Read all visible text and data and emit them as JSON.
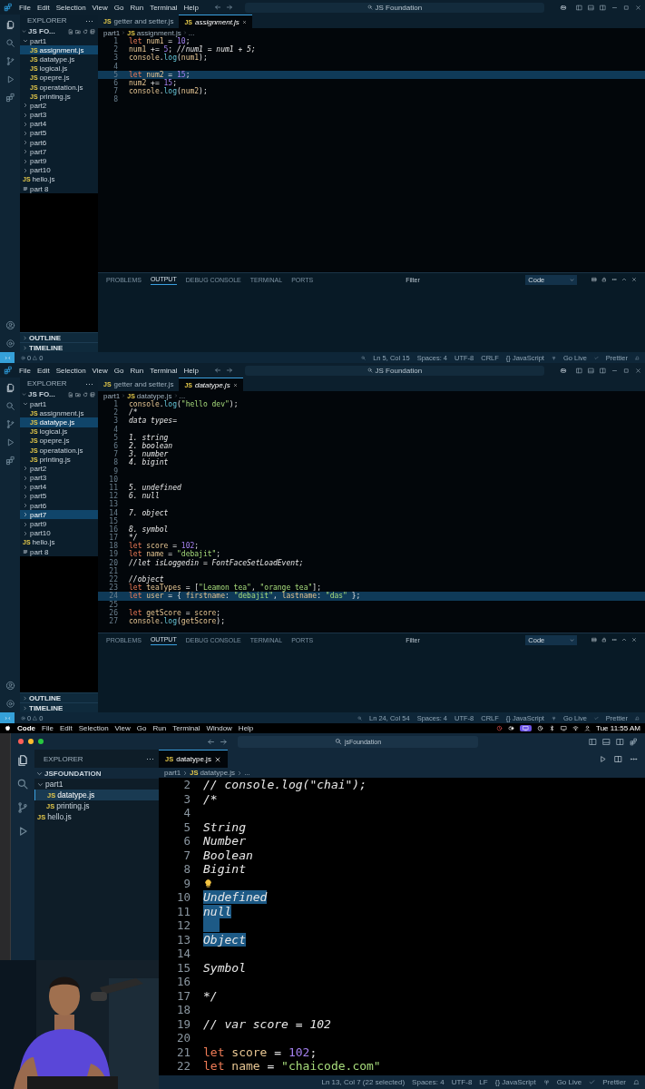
{
  "windows": [
    {
      "kind": "windows",
      "menu": [
        "File",
        "Edit",
        "Selection",
        "View",
        "Go",
        "Run",
        "Terminal",
        "Help"
      ],
      "title": "JS Foundation",
      "explorer": {
        "title": "EXPLORER",
        "more": "···",
        "root": "JS FO...",
        "tree": [
          {
            "label": "part1",
            "kind": "folder",
            "expanded": true,
            "selected": false,
            "children": [
              {
                "label": "assignment.js",
                "kind": "file",
                "badge": "JS",
                "selected": true
              },
              {
                "label": "datatype.js",
                "kind": "file",
                "badge": "JS",
                "selected": false
              },
              {
                "label": "logical.js",
                "kind": "file",
                "badge": "JS",
                "selected": false
              },
              {
                "label": "opepre.js",
                "kind": "file",
                "badge": "JS",
                "selected": false
              },
              {
                "label": "operatation.js",
                "kind": "file",
                "badge": "JS",
                "selected": false
              },
              {
                "label": "printing.js",
                "kind": "file",
                "badge": "JS",
                "selected": false
              }
            ]
          },
          {
            "label": "part2",
            "kind": "folder",
            "expanded": false,
            "selected": false
          },
          {
            "label": "part3",
            "kind": "folder",
            "expanded": false,
            "selected": false
          },
          {
            "label": "part4",
            "kind": "folder",
            "expanded": false,
            "selected": false
          },
          {
            "label": "part5",
            "kind": "folder",
            "expanded": false,
            "selected": false
          },
          {
            "label": "part6",
            "kind": "folder",
            "expanded": false,
            "selected": false
          },
          {
            "label": "part7",
            "kind": "folder",
            "expanded": false,
            "selected": false
          },
          {
            "label": "part9",
            "kind": "folder",
            "expanded": false,
            "selected": false
          },
          {
            "label": "part10",
            "kind": "folder",
            "expanded": false,
            "selected": false
          },
          {
            "label": "hello.js",
            "kind": "file",
            "badge": "JS",
            "selected": false
          },
          {
            "label": "part 8",
            "kind": "file",
            "selected": false
          }
        ],
        "sections": [
          "OUTLINE",
          "TIMELINE"
        ]
      },
      "tabs": [
        {
          "label": "getter and setter.js",
          "badge": "JS",
          "selected": false
        },
        {
          "label": "assignment.js",
          "badge": "JS",
          "selected": true
        }
      ],
      "breadcrumb": [
        {
          "text": "part1"
        },
        {
          "text": "assignment.js",
          "badge": "JS"
        },
        {
          "text": "..."
        }
      ],
      "lines": [
        {
          "number": "1",
          "selected": false,
          "tokens": [
            {
              "text": "let",
              "kind": "keyword"
            },
            {
              "text": " num1",
              "kind": "variable"
            },
            {
              "text": " = ",
              "kind": "plain"
            },
            {
              "text": "10",
              "kind": "number"
            },
            {
              "text": ";",
              "kind": "plain"
            }
          ]
        },
        {
          "number": "2",
          "selected": false,
          "tokens": [
            {
              "text": "num1",
              "kind": "variable"
            },
            {
              "text": " += ",
              "kind": "plain"
            },
            {
              "text": "5",
              "kind": "number"
            },
            {
              "text": "; ",
              "kind": "plain"
            },
            {
              "text": "//num1 = num1 + 5;",
              "kind": "comment"
            }
          ]
        },
        {
          "number": "3",
          "selected": false,
          "tokens": [
            {
              "text": "console",
              "kind": "variable"
            },
            {
              "text": ".",
              "kind": "plain"
            },
            {
              "text": "log",
              "kind": "function"
            },
            {
              "text": "(",
              "kind": "plain"
            },
            {
              "text": "num1",
              "kind": "variable"
            },
            {
              "text": ");",
              "kind": "plain"
            }
          ]
        },
        {
          "number": "4",
          "selected": false
        },
        {
          "number": "5",
          "selected": true,
          "tokens": [
            {
              "text": "let",
              "kind": "keyword"
            },
            {
              "text": " num2",
              "kind": "variable"
            },
            {
              "text": " = ",
              "kind": "plain"
            },
            {
              "text": "15",
              "kind": "number"
            },
            {
              "text": ";",
              "kind": "plain"
            }
          ]
        },
        {
          "number": "6",
          "selected": false,
          "tokens": [
            {
              "text": "num2",
              "kind": "variable"
            },
            {
              "text": " += ",
              "kind": "plain"
            },
            {
              "text": "15",
              "kind": "number"
            },
            {
              "text": ";",
              "kind": "plain"
            }
          ]
        },
        {
          "number": "7",
          "selected": false,
          "tokens": [
            {
              "text": "console",
              "kind": "variable"
            },
            {
              "text": ".",
              "kind": "plain"
            },
            {
              "text": "log",
              "kind": "function"
            },
            {
              "text": "(",
              "kind": "plain"
            },
            {
              "text": "num2",
              "kind": "variable"
            },
            {
              "text": ");",
              "kind": "plain"
            }
          ]
        },
        {
          "number": "8",
          "selected": false
        }
      ],
      "panel": {
        "tabs": [
          {
            "label": "PROBLEMS",
            "selected": false
          },
          {
            "label": "OUTPUT",
            "selected": true
          },
          {
            "label": "DEBUG CONSOLE",
            "selected": false
          },
          {
            "label": "TERMINAL",
            "selected": false
          },
          {
            "label": "PORTS",
            "selected": false
          }
        ],
        "filter_placeholder": "Filter",
        "channel": "Code"
      },
      "status": {
        "errors": "0",
        "warnings": "0",
        "items": [
          {
            "text": "Ln 5, Col 15"
          },
          {
            "text": "Spaces: 4"
          },
          {
            "text": "UTF-8"
          },
          {
            "text": "CRLF"
          },
          {
            "text": "{} JavaScript"
          },
          {
            "text": "Go Live"
          },
          {
            "text": "Prettier"
          }
        ]
      }
    },
    {
      "kind": "windows",
      "menu": [
        "File",
        "Edit",
        "Selection",
        "View",
        "Go",
        "Run",
        "Terminal",
        "Help"
      ],
      "title": "JS Foundation",
      "explorer": {
        "title": "EXPLORER",
        "more": "···",
        "root": "JS FO...",
        "tree": [
          {
            "label": "part1",
            "kind": "folder",
            "expanded": true,
            "selected": false,
            "children": [
              {
                "label": "assignment.js",
                "kind": "file",
                "badge": "JS",
                "selected": false
              },
              {
                "label": "datatype.js",
                "kind": "file",
                "badge": "JS",
                "selected": true
              },
              {
                "label": "logical.js",
                "kind": "file",
                "badge": "JS",
                "selected": false
              },
              {
                "label": "opepre.js",
                "kind": "file",
                "badge": "JS",
                "selected": false
              },
              {
                "label": "operatation.js",
                "kind": "file",
                "badge": "JS",
                "selected": false
              },
              {
                "label": "printing.js",
                "kind": "file",
                "badge": "JS",
                "selected": false
              }
            ]
          },
          {
            "label": "part2",
            "kind": "folder",
            "expanded": false,
            "selected": false
          },
          {
            "label": "part3",
            "kind": "folder",
            "expanded": false,
            "selected": false
          },
          {
            "label": "part4",
            "kind": "folder",
            "expanded": false,
            "selected": false
          },
          {
            "label": "part5",
            "kind": "folder",
            "expanded": false,
            "selected": false
          },
          {
            "label": "part6",
            "kind": "folder",
            "expanded": false,
            "selected": false
          },
          {
            "label": "part7",
            "kind": "folder",
            "expanded": false,
            "selected": true
          },
          {
            "label": "part9",
            "kind": "folder",
            "expanded": false,
            "selected": false
          },
          {
            "label": "part10",
            "kind": "folder",
            "expanded": false,
            "selected": false
          },
          {
            "label": "hello.js",
            "kind": "file",
            "badge": "JS",
            "selected": false
          },
          {
            "label": "part 8",
            "kind": "file",
            "selected": false
          }
        ],
        "sections": [
          "OUTLINE",
          "TIMELINE"
        ]
      },
      "tabs": [
        {
          "label": "getter and setter.js",
          "badge": "JS",
          "selected": false
        },
        {
          "label": "datatype.js",
          "badge": "JS",
          "selected": true
        }
      ],
      "breadcrumb": [
        {
          "text": "part1"
        },
        {
          "text": "datatype.js",
          "badge": "JS"
        },
        {
          "text": "..."
        }
      ],
      "lines": [
        {
          "number": "1",
          "selected": false,
          "tokens": [
            {
              "text": "console",
              "kind": "variable"
            },
            {
              "text": ".",
              "kind": "plain"
            },
            {
              "text": "log",
              "kind": "function"
            },
            {
              "text": "(",
              "kind": "plain"
            },
            {
              "text": "\"hello dev\"",
              "kind": "string"
            },
            {
              "text": ");",
              "kind": "plain"
            }
          ]
        },
        {
          "number": "2",
          "selected": false,
          "tokens": [
            {
              "text": "/*",
              "kind": "comment"
            }
          ]
        },
        {
          "number": "3",
          "selected": false,
          "tokens": [
            {
              "text": "data types=",
              "kind": "comment"
            }
          ]
        },
        {
          "number": "4",
          "selected": false
        },
        {
          "number": "5",
          "selected": false,
          "tokens": [
            {
              "text": "1. string",
              "kind": "comment"
            }
          ]
        },
        {
          "number": "6",
          "selected": false,
          "tokens": [
            {
              "text": "2. boolean",
              "kind": "comment"
            }
          ]
        },
        {
          "number": "7",
          "selected": false,
          "tokens": [
            {
              "text": "3. number",
              "kind": "comment"
            }
          ]
        },
        {
          "number": "8",
          "selected": false,
          "tokens": [
            {
              "text": "4. bigint",
              "kind": "comment"
            }
          ]
        },
        {
          "number": "9",
          "selected": false
        },
        {
          "number": "10",
          "selected": false
        },
        {
          "number": "11",
          "selected": false,
          "tokens": [
            {
              "text": "5. undefined",
              "kind": "comment"
            }
          ]
        },
        {
          "number": "12",
          "selected": false,
          "tokens": [
            {
              "text": "6. null",
              "kind": "comment"
            }
          ]
        },
        {
          "number": "13",
          "selected": false
        },
        {
          "number": "14",
          "selected": false,
          "tokens": [
            {
              "text": "7. object",
              "kind": "comment"
            }
          ]
        },
        {
          "number": "15",
          "selected": false
        },
        {
          "number": "16",
          "selected": false,
          "tokens": [
            {
              "text": "8. symbol",
              "kind": "comment"
            }
          ]
        },
        {
          "number": "17",
          "selected": false,
          "tokens": [
            {
              "text": "*/",
              "kind": "comment"
            }
          ]
        },
        {
          "number": "18",
          "selected": false,
          "tokens": [
            {
              "text": "let",
              "kind": "keyword"
            },
            {
              "text": " score",
              "kind": "variable"
            },
            {
              "text": " = ",
              "kind": "plain"
            },
            {
              "text": "102",
              "kind": "number"
            },
            {
              "text": ";",
              "kind": "plain"
            }
          ]
        },
        {
          "number": "19",
          "selected": false,
          "tokens": [
            {
              "text": "let",
              "kind": "keyword"
            },
            {
              "text": " name",
              "kind": "variable"
            },
            {
              "text": " = ",
              "kind": "plain"
            },
            {
              "text": "\"debajit\"",
              "kind": "string"
            },
            {
              "text": ";",
              "kind": "plain"
            }
          ]
        },
        {
          "number": "20",
          "selected": false,
          "tokens": [
            {
              "text": "//let isLoggedin = FontFaceSetLoadEvent;",
              "kind": "comment"
            }
          ]
        },
        {
          "number": "21",
          "selected": false
        },
        {
          "number": "22",
          "selected": false,
          "tokens": [
            {
              "text": "//object",
              "kind": "comment"
            }
          ]
        },
        {
          "number": "23",
          "selected": false,
          "tokens": [
            {
              "text": "let",
              "kind": "keyword"
            },
            {
              "text": " teaTypes",
              "kind": "variable"
            },
            {
              "text": " = [",
              "kind": "plain"
            },
            {
              "text": "\"Leamon tea\"",
              "kind": "string"
            },
            {
              "text": ", ",
              "kind": "plain"
            },
            {
              "text": "\"orange tea\"",
              "kind": "string"
            },
            {
              "text": "];",
              "kind": "plain"
            }
          ]
        },
        {
          "number": "24",
          "selected": true,
          "tokens": [
            {
              "text": "let",
              "kind": "keyword"
            },
            {
              "text": " user",
              "kind": "variable"
            },
            {
              "text": " = { ",
              "kind": "plain"
            },
            {
              "text": "firstname",
              "kind": "variable"
            },
            {
              "text": ": ",
              "kind": "plain"
            },
            {
              "text": "\"debajit\"",
              "kind": "string"
            },
            {
              "text": ", ",
              "kind": "plain"
            },
            {
              "text": "lastname",
              "kind": "variable"
            },
            {
              "text": ": ",
              "kind": "plain"
            },
            {
              "text": "\"das\"",
              "kind": "string"
            },
            {
              "text": " };",
              "kind": "plain"
            }
          ]
        },
        {
          "number": "25",
          "selected": false
        },
        {
          "number": "26",
          "selected": false,
          "tokens": [
            {
              "text": "let",
              "kind": "keyword"
            },
            {
              "text": " getScore",
              "kind": "variable"
            },
            {
              "text": " = ",
              "kind": "plain"
            },
            {
              "text": "score",
              "kind": "variable"
            },
            {
              "text": ";",
              "kind": "plain"
            }
          ]
        },
        {
          "number": "27",
          "selected": false,
          "tokens": [
            {
              "text": "console",
              "kind": "variable"
            },
            {
              "text": ".",
              "kind": "plain"
            },
            {
              "text": "log",
              "kind": "function"
            },
            {
              "text": "(",
              "kind": "plain"
            },
            {
              "text": "getScore",
              "kind": "variable"
            },
            {
              "text": ");",
              "kind": "plain"
            }
          ]
        }
      ],
      "panel": {
        "tabs": [
          {
            "label": "PROBLEMS",
            "selected": false
          },
          {
            "label": "OUTPUT",
            "selected": true
          },
          {
            "label": "DEBUG CONSOLE",
            "selected": false
          },
          {
            "label": "TERMINAL",
            "selected": false
          },
          {
            "label": "PORTS",
            "selected": false
          }
        ],
        "filter_placeholder": "Filter",
        "channel": "Code"
      },
      "status": {
        "errors": "0",
        "warnings": "0",
        "items": [
          {
            "text": "Ln 24, Col 54"
          },
          {
            "text": "Spaces: 4"
          },
          {
            "text": "UTF-8"
          },
          {
            "text": "CRLF"
          },
          {
            "text": "{} JavaScript"
          },
          {
            "text": "Go Live"
          },
          {
            "text": "Prettier"
          }
        ]
      }
    },
    {
      "kind": "mac",
      "menu": [
        "File",
        "Edit",
        "Selection",
        "View",
        "Go",
        "Run",
        "Terminal",
        "Window",
        "Help"
      ],
      "app": "Code",
      "clock": "Tue 11:55 AM",
      "title": "jsFoundation",
      "explorer": {
        "title": "EXPLORER",
        "more": "···",
        "root": "JSFOUNDATION",
        "tree": [
          {
            "label": "part1",
            "kind": "folder",
            "expanded": true,
            "selected": false,
            "children": [
              {
                "label": "datatype.js",
                "kind": "file",
                "badge": "JS",
                "selected": true
              },
              {
                "label": "printing.js",
                "kind": "file",
                "badge": "JS",
                "selected": false
              }
            ]
          },
          {
            "label": "hello.js",
            "kind": "file",
            "badge": "JS",
            "selected": false
          }
        ]
      },
      "tabs": [
        {
          "label": "datatype.js",
          "badge": "JS",
          "selected": true
        }
      ],
      "breadcrumb": [
        {
          "text": "part1"
        },
        {
          "text": "datatype.js",
          "badge": "JS"
        },
        {
          "text": "..."
        }
      ],
      "lines": [
        {
          "number": "2",
          "selected": false,
          "tokens": [
            {
              "text": "// console.log(\"chai\");",
              "kind": "comment"
            }
          ]
        },
        {
          "number": "3",
          "selected": false,
          "tokens": [
            {
              "text": "/*",
              "kind": "comment"
            }
          ]
        },
        {
          "number": "4",
          "selected": false
        },
        {
          "number": "5",
          "selected": false,
          "tokens": [
            {
              "text": "String",
              "kind": "comment"
            }
          ]
        },
        {
          "number": "6",
          "selected": false,
          "tokens": [
            {
              "text": "Number",
              "kind": "comment"
            }
          ]
        },
        {
          "number": "7",
          "selected": false,
          "tokens": [
            {
              "text": "Boolean",
              "kind": "comment"
            }
          ]
        },
        {
          "number": "8",
          "selected": false,
          "tokens": [
            {
              "text": "Bigint",
              "kind": "comment"
            }
          ]
        },
        {
          "number": "9",
          "selected": false,
          "lightbulb": true
        },
        {
          "number": "10",
          "selected": true,
          "tokens": [
            {
              "text": "Undefined",
              "kind": "comment"
            }
          ]
        },
        {
          "number": "11",
          "selected": true,
          "tokens": [
            {
              "text": "null",
              "kind": "comment"
            }
          ]
        },
        {
          "number": "12",
          "selected": true
        },
        {
          "number": "13",
          "selected": true,
          "tokens": [
            {
              "text": "Object",
              "kind": "comment"
            }
          ]
        },
        {
          "number": "14",
          "selected": false
        },
        {
          "number": "15",
          "selected": false,
          "tokens": [
            {
              "text": "Symbol",
              "kind": "comment"
            }
          ]
        },
        {
          "number": "16",
          "selected": false
        },
        {
          "number": "17",
          "selected": false,
          "tokens": [
            {
              "text": "*/",
              "kind": "comment"
            }
          ]
        },
        {
          "number": "18",
          "selected": false
        },
        {
          "number": "19",
          "selected": false,
          "tokens": [
            {
              "text": "// var score = 102",
              "kind": "comment"
            }
          ]
        },
        {
          "number": "20",
          "selected": false
        },
        {
          "number": "21",
          "selected": false,
          "tokens": [
            {
              "text": "let",
              "kind": "keyword"
            },
            {
              "text": " score",
              "kind": "variable"
            },
            {
              "text": " = ",
              "kind": "plain"
            },
            {
              "text": "102",
              "kind": "number"
            },
            {
              "text": ";",
              "kind": "plain"
            }
          ]
        },
        {
          "number": "22",
          "selected": false,
          "tokens": [
            {
              "text": "let",
              "kind": "keyword"
            },
            {
              "text": " name",
              "kind": "variable"
            },
            {
              "text": " = ",
              "kind": "plain"
            },
            {
              "text": "\"chaicode.com\"",
              "kind": "string"
            }
          ]
        }
      ],
      "status": {
        "items": [
          {
            "text": "Ln 13, Col 7 (22 selected)"
          },
          {
            "text": "Spaces: 4"
          },
          {
            "text": "UTF-8"
          },
          {
            "text": "LF"
          },
          {
            "text": "{} JavaScript"
          },
          {
            "text": "Go Live"
          },
          {
            "text": "Prettier"
          }
        ]
      },
      "webcam": {
        "kind": "picture"
      }
    }
  ]
}
